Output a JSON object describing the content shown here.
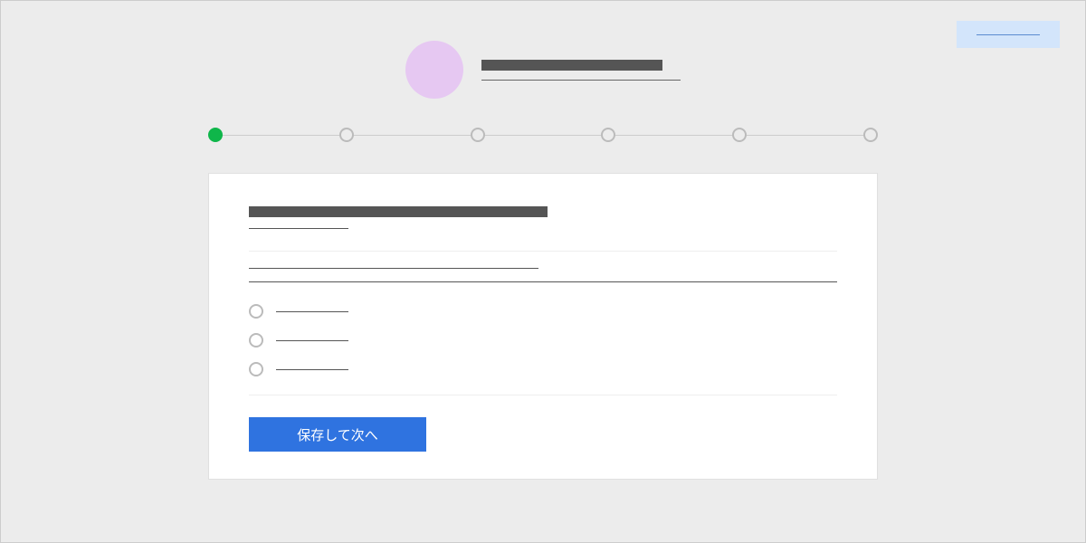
{
  "header": {
    "title_placeholder": "",
    "subtitle_placeholder": "",
    "top_button_label": ""
  },
  "stepper": {
    "total_steps": 6,
    "current_step": 1
  },
  "form": {
    "section_title_placeholder": "",
    "section_subtitle_placeholder": "",
    "question_line_1": "",
    "question_line_2": "",
    "options": [
      {
        "label": ""
      },
      {
        "label": ""
      },
      {
        "label": ""
      }
    ],
    "submit_label": "保存して次へ"
  }
}
